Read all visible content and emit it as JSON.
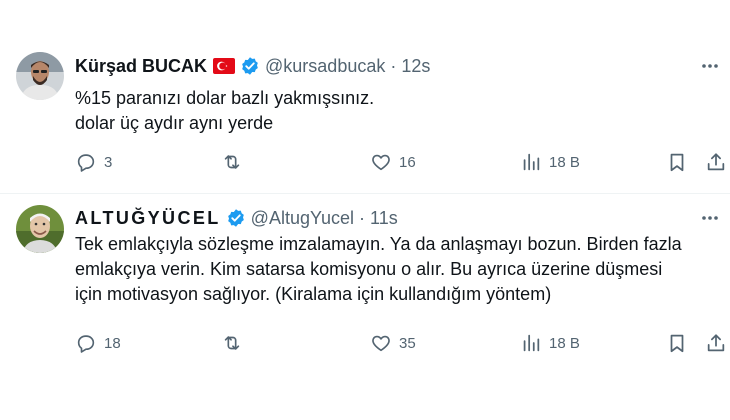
{
  "tweets": [
    {
      "author_name": "Kürşad BUCAK",
      "flag_icon": "turkey-flag-icon",
      "verified_icon": "verified-badge-icon",
      "handle": "@kursadbucak",
      "separator": "·",
      "time": "12s",
      "text_lines": [
        "%15 paranızı dolar bazlı yakmışsınız.",
        "dolar üç aydır aynı yerde"
      ],
      "stats": {
        "replies": "3",
        "retweets": "",
        "likes": "16",
        "views": "18 B"
      }
    },
    {
      "author_name": "ALTUĞYÜCEL",
      "verified_icon": "verified-badge-icon",
      "handle": "@AltugYucel",
      "separator": "·",
      "time": "11s",
      "text_lines": [
        "Tek emlakçıyla sözleşme imzalamayın. Ya da anlaşmayı bozun. Birden fazla",
        "emlakçıya verin. Kim satarsa komisyonu o alır. Bu ayrıca üzerine düşmesi",
        "için motivasyon sağlıyor. (Kiralama için kullandığım yöntem)"
      ],
      "stats": {
        "replies": "18",
        "retweets": "",
        "likes": "35",
        "views": "18 B"
      }
    }
  ],
  "colors": {
    "text": "#0f1419",
    "muted": "#536471",
    "verified": "#1d9bf0",
    "flag_red": "#e30a17",
    "divider": "#eff3f4"
  },
  "icons": [
    "reply-icon",
    "retweet-icon",
    "like-icon",
    "views-icon",
    "bookmark-icon",
    "share-icon",
    "more-icon"
  ]
}
